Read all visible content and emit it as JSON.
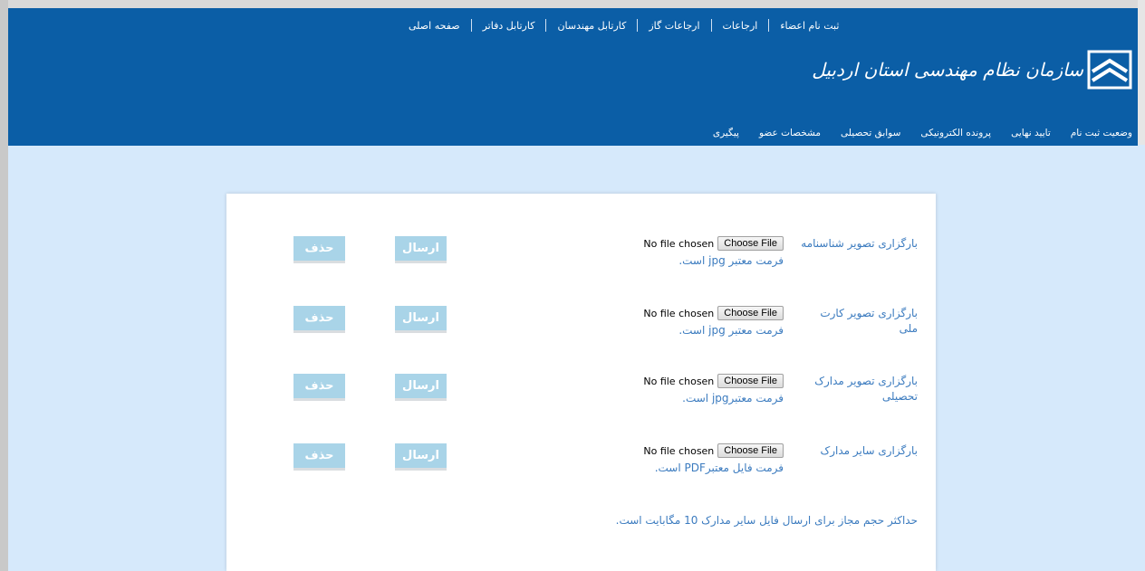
{
  "top_nav": [
    "صفحه اصلی",
    "کارتابل دفاتر",
    "کارتابل مهندسان",
    "ارجاعات گاز",
    "ارجاعات",
    "ثبت نام اعضاء"
  ],
  "logo_text": "سازمان نظام مهندسی استان اردبیل",
  "sub_nav": [
    "پیگیری",
    "مشخصات عضو",
    "سوابق تحصیلی",
    "پرونده الکترونیکی",
    "تایید نهایی",
    "وضعیت ثبت نام"
  ],
  "colors": {
    "header_bg": "#0b5ea6",
    "page_bg": "#d6e9fb",
    "button_bg": "#a9d4e8",
    "link_text": "#3b7bbf"
  },
  "uploads": [
    {
      "label": "بارگزاری تصویر شناسنامه",
      "file_status": "No file chosen",
      "choose_label": "Choose File",
      "format_note": "فرمت معتبر jpg است.",
      "send_label": "ارسال",
      "delete_label": "حذف"
    },
    {
      "label": "بارگزاری تصویر کارت ملی",
      "file_status": "No file chosen",
      "choose_label": "Choose File",
      "format_note": "فرمت معتبر jpg است.",
      "send_label": "ارسال",
      "delete_label": "حذف"
    },
    {
      "label": "بارگزاری تصویر مدارک تحصیلی",
      "file_status": "No file chosen",
      "choose_label": "Choose File",
      "format_note": "فرمت معتبرjpg است.",
      "send_label": "ارسال",
      "delete_label": "حذف"
    },
    {
      "label": "بارگزاری سایر مدارک",
      "file_status": "No file chosen",
      "choose_label": "Choose File",
      "format_note": "فرمت فایل معتبرPDF است.",
      "send_label": "ارسال",
      "delete_label": "حذف"
    }
  ],
  "max_size_note": "حداکثر حجم مجاز برای ارسال فایل سایر مدارک 10 مگابایت است."
}
